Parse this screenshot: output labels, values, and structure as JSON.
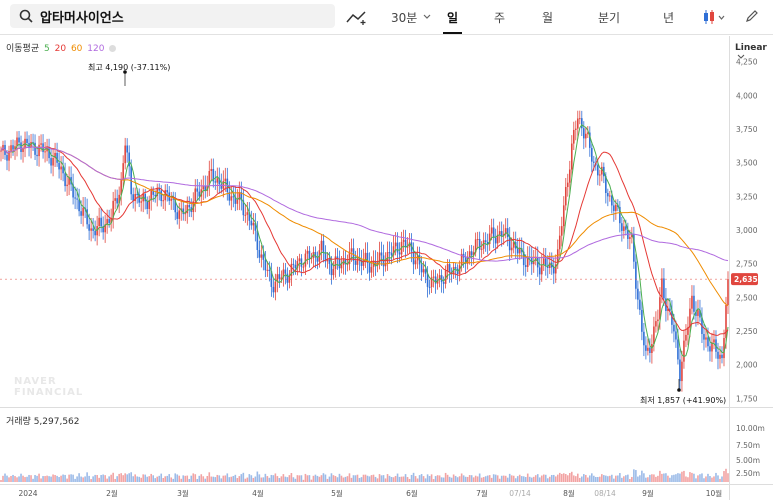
{
  "header": {
    "stock_name": "압타머사이언스",
    "interval_label": "30분",
    "tabs": [
      "일",
      "주",
      "월",
      "분기",
      "년"
    ],
    "active_tab": "일"
  },
  "ma_legend": {
    "label": "이동평균",
    "periods": [
      "5",
      "20",
      "60",
      "120"
    ],
    "colors": [
      "#4caf50",
      "#e53935",
      "#ef8c00",
      "#b06adf"
    ]
  },
  "scale_label": "Linear",
  "volume_label": "거래량 5,297,562",
  "watermark": [
    "NAVER",
    "FINANCIAL"
  ],
  "colors": {
    "up": "#e0463e",
    "down": "#2f6fd6",
    "vol_up": "#f2a3a3",
    "vol_down": "#9cbbe8",
    "current_badge": "#e0463e",
    "ma5": "#4caf50",
    "ma20": "#e53935",
    "ma60": "#ef8c00",
    "ma120": "#b06adf"
  },
  "chart_data": {
    "type": "candlestick",
    "title": "",
    "y_ticks": [
      "4,250",
      "4,000",
      "3,750",
      "3,500",
      "3,250",
      "3,000",
      "2,750",
      "2,500",
      "2,250",
      "2,000",
      "1,750"
    ],
    "ylim": [
      1700,
      4300
    ],
    "volume_ticks": [
      "10.00m",
      "7.50m",
      "5.00m",
      "2.50m"
    ],
    "x_ticks": [
      "2024",
      "2월",
      "3월",
      "4월",
      "5월",
      "6월",
      "7월",
      "07/14",
      "8월",
      "08/14",
      "9월",
      "10월"
    ],
    "current_price": "2,635",
    "annotations": {
      "high": {
        "label": "최고",
        "value": "4,190 (-37.11%)"
      },
      "low": {
        "label": "최저",
        "value": "1,857 (+41.90%)"
      }
    },
    "close_path": [
      [
        0,
        3560
      ],
      [
        5,
        3600
      ],
      [
        10,
        3650
      ],
      [
        15,
        3620
      ],
      [
        20,
        3600
      ],
      [
        25,
        3550
      ],
      [
        30,
        3450
      ],
      [
        35,
        3300
      ],
      [
        40,
        3150
      ],
      [
        45,
        3000
      ],
      [
        50,
        3020
      ],
      [
        55,
        3100
      ],
      [
        60,
        3350
      ],
      [
        62,
        3650
      ],
      [
        65,
        3300
      ],
      [
        70,
        3200
      ],
      [
        75,
        3250
      ],
      [
        80,
        3280
      ],
      [
        85,
        3220
      ],
      [
        90,
        3100
      ],
      [
        95,
        3200
      ],
      [
        100,
        3300
      ],
      [
        105,
        3400
      ],
      [
        110,
        3350
      ],
      [
        115,
        3250
      ],
      [
        120,
        3200
      ],
      [
        125,
        3050
      ],
      [
        130,
        2800
      ],
      [
        135,
        2600
      ],
      [
        140,
        2650
      ],
      [
        145,
        2700
      ],
      [
        150,
        2780
      ],
      [
        155,
        2800
      ],
      [
        160,
        2850
      ],
      [
        165,
        2720
      ],
      [
        170,
        2760
      ],
      [
        175,
        2800
      ],
      [
        180,
        2770
      ],
      [
        185,
        2740
      ],
      [
        190,
        2780
      ],
      [
        195,
        2830
      ],
      [
        200,
        2900
      ],
      [
        205,
        2850
      ],
      [
        210,
        2700
      ],
      [
        215,
        2600
      ],
      [
        220,
        2650
      ],
      [
        225,
        2700
      ],
      [
        230,
        2750
      ],
      [
        235,
        2850
      ],
      [
        240,
        2900
      ],
      [
        245,
        2950
      ],
      [
        250,
        2980
      ],
      [
        255,
        2900
      ],
      [
        260,
        2800
      ],
      [
        265,
        2760
      ],
      [
        270,
        2740
      ],
      [
        275,
        2720
      ],
      [
        278,
        2800
      ],
      [
        282,
        3300
      ],
      [
        285,
        3600
      ],
      [
        288,
        3850
      ],
      [
        292,
        3700
      ],
      [
        296,
        3500
      ],
      [
        300,
        3400
      ],
      [
        305,
        3200
      ],
      [
        310,
        3050
      ],
      [
        315,
        2900
      ],
      [
        318,
        2500
      ],
      [
        320,
        2250
      ],
      [
        322,
        2050
      ],
      [
        325,
        2200
      ],
      [
        328,
        2350
      ],
      [
        330,
        2600
      ],
      [
        333,
        2400
      ],
      [
        336,
        2250
      ],
      [
        339,
        1950
      ],
      [
        342,
        2200
      ],
      [
        345,
        2500
      ],
      [
        348,
        2350
      ],
      [
        351,
        2200
      ],
      [
        354,
        2150
      ],
      [
        357,
        2100
      ],
      [
        360,
        2050
      ],
      [
        363,
        2635
      ]
    ]
  }
}
